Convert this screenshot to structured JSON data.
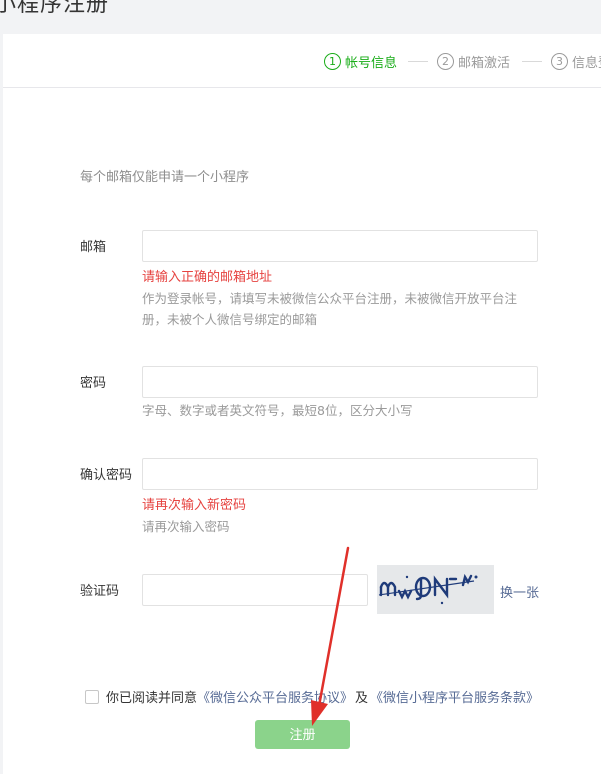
{
  "page": {
    "title": "小程序注册"
  },
  "steps": [
    {
      "num": "1",
      "label": "帐号信息"
    },
    {
      "num": "2",
      "label": "邮箱激活"
    },
    {
      "num": "3",
      "label": "信息登"
    }
  ],
  "form": {
    "tip": "每个邮箱仅能申请一个小程序",
    "email": {
      "label": "邮箱",
      "value": "",
      "error": "请输入正确的邮箱地址",
      "hint": "作为登录帐号，请填写未被微信公众平台注册，未被微信开放平台注册，未被个人微信号绑定的邮箱"
    },
    "password": {
      "label": "密码",
      "value": "",
      "hint": "字母、数字或者英文符号，最短8位，区分大小写"
    },
    "confirm_password": {
      "label": "确认密码",
      "value": "",
      "error": "请再次输入新密码",
      "hint": "请再次输入密码"
    },
    "captcha": {
      "label": "验证码",
      "value": "",
      "refresh_label": "换一张"
    }
  },
  "agreement": {
    "prefix": "你已阅读并同意",
    "link1": "《微信公众平台服务协议》",
    "middle": "及",
    "link2": "《微信小程序平台服务条款》",
    "checked": false
  },
  "submit": {
    "label": "注册"
  },
  "colors": {
    "accent": "#1aad19",
    "button_disabled": "#8bd38b",
    "error": "#e64340",
    "link": "#576b95",
    "annotation_arrow": "#e0302a"
  }
}
